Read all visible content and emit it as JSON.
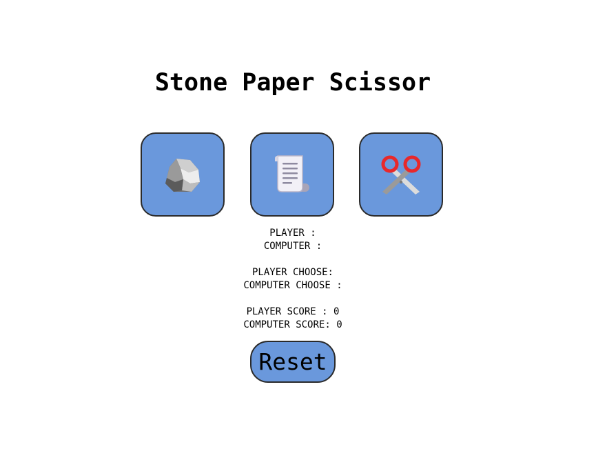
{
  "title": "Stone Paper Scissor",
  "choices": [
    {
      "id": "stone",
      "icon": "stone-icon"
    },
    {
      "id": "paper",
      "icon": "paper-scroll-icon"
    },
    {
      "id": "scissor",
      "icon": "scissors-icon"
    }
  ],
  "status": {
    "player_label": "PLAYER :",
    "computer_label": "COMPUTER :",
    "player_choose_label": "PLAYER CHOOSE:",
    "computer_choose_label": "COMPUTER CHOOSE :",
    "player_score_label": "PLAYER SCORE : 0",
    "computer_score_label": "COMPUTER SCORE: 0"
  },
  "reset_label": "Reset",
  "colors": {
    "button_bg": "#6a98dc",
    "button_border": "#2a2a2a",
    "scissor_handle": "#e8282b"
  }
}
